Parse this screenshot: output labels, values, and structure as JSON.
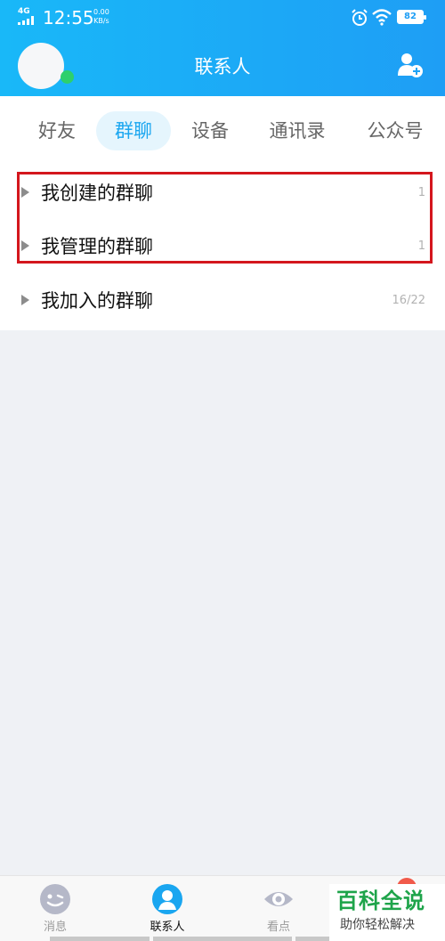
{
  "status_bar": {
    "network": "4G",
    "time": "12:55",
    "speed_value": "0.00",
    "speed_unit": "KB/s",
    "battery": "82"
  },
  "header": {
    "title": "联系人",
    "avatar_icon": "user-avatar",
    "add_icon": "add-contact-icon"
  },
  "tabs": [
    {
      "label": "好友",
      "active": false
    },
    {
      "label": "群聊",
      "active": true
    },
    {
      "label": "设备",
      "active": false
    },
    {
      "label": "通讯录",
      "active": false
    },
    {
      "label": "公众号",
      "active": false
    }
  ],
  "groups": [
    {
      "label": "我创建的群聊",
      "count": "1"
    },
    {
      "label": "我管理的群聊",
      "count": "1"
    },
    {
      "label": "我加入的群聊",
      "count": "16/22"
    }
  ],
  "bottom_nav": [
    {
      "label": "消息",
      "icon": "message-icon",
      "active": false
    },
    {
      "label": "联系人",
      "icon": "contacts-icon",
      "active": true
    },
    {
      "label": "看点",
      "icon": "eye-icon",
      "active": false
    }
  ],
  "watermark": {
    "main": "百科全说",
    "sub": "助你轻松解决"
  },
  "colors": {
    "accent": "#1aa6f0",
    "highlight": "#d4161d",
    "online": "#2ed06c"
  }
}
